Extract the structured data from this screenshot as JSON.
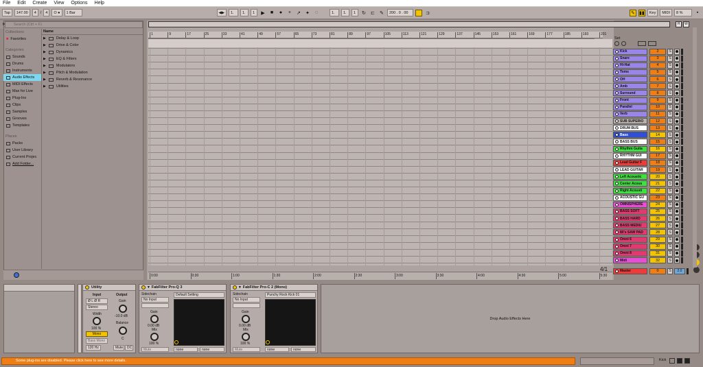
{
  "menu": [
    "File",
    "Edit",
    "Create",
    "View",
    "Options",
    "Help"
  ],
  "control": {
    "tap": "Tap",
    "tempo": "147.00",
    "sig_num": "4",
    "sig_den": "4",
    "quant": "1 Bar",
    "pos1": "1.",
    "pos2": "1.",
    "pos3": "1",
    "loop1": "1.",
    "loop2": "1.",
    "loop3": "1",
    "zoom": "200 . 0 . 00",
    "key": "Key",
    "midi": "MIDI",
    "cpu": "8 %",
    "o": "O ●"
  },
  "browser": {
    "search_placeholder": "Search (Ctrl + F)",
    "collections_header": "Collections",
    "favorites": "Favorites",
    "categories_header": "Categories",
    "categories": [
      "Sounds",
      "Drums",
      "Instruments",
      "Audio Effects",
      "MIDI Effects",
      "Max for Live",
      "Plug-Ins",
      "Clips",
      "Samples",
      "Grooves",
      "Templates"
    ],
    "places_header": "Places",
    "places": [
      "Packs",
      "User Library",
      "Current Projec",
      "Add Folder..."
    ],
    "name_header": "Name",
    "folders": [
      "Delay & Loop",
      "Drive & Color",
      "Dynamics",
      "EQ & Filters",
      "Modulators",
      "Pitch & Modulation",
      "Reverb & Resonance",
      "Utilities"
    ]
  },
  "ruler": {
    "bars": [
      "1",
      "9",
      "17",
      "25",
      "33",
      "41",
      "49",
      "57",
      "65",
      "73",
      "81",
      "89",
      "97",
      "105",
      "113",
      "121",
      "129",
      "137",
      "145",
      "153",
      "161",
      "169",
      "177",
      "185",
      "193",
      "201"
    ],
    "times": [
      "0:00",
      "0:30",
      "1:00",
      "1:30",
      "2:00",
      "2:30",
      "3:00",
      "3:30",
      "4:00",
      "4:30",
      "5:00",
      "5:30"
    ],
    "signature": "4/1",
    "set_label": "Set"
  },
  "tracks": [
    {
      "name": "Kick",
      "num": "2",
      "color": "#9a86e8",
      "numcolor": "#ef7f14"
    },
    {
      "name": "Snare",
      "num": "3",
      "color": "#9a86e8",
      "numcolor": "#ef7f14"
    },
    {
      "name": "Hi-Hat",
      "num": "4",
      "color": "#9a86e8",
      "numcolor": "#ef7f14"
    },
    {
      "name": "Toms",
      "num": "5",
      "color": "#9a86e8",
      "numcolor": "#ef7f14"
    },
    {
      "name": "OH",
      "num": "6",
      "color": "#9a86e8",
      "numcolor": "#ef7f14"
    },
    {
      "name": "Amb",
      "num": "7",
      "color": "#9a86e8",
      "numcolor": "#ef7f14"
    },
    {
      "name": "Surround",
      "num": "8",
      "color": "#9a86e8",
      "numcolor": "#ef7f14"
    },
    {
      "name": "Front",
      "num": "9",
      "color": "#9a86e8",
      "numcolor": "#ef7f14"
    },
    {
      "name": "Parallel",
      "num": "10",
      "color": "#9a86e8",
      "numcolor": "#ef7f14"
    },
    {
      "name": "Verb",
      "num": "11",
      "color": "#9a86e8",
      "numcolor": "#ef7f14"
    },
    {
      "name": "SUB SUPERIO",
      "num": "12",
      "color": "#b9b0ad",
      "numcolor": "#ef7f14"
    },
    {
      "name": "DRUM BUS",
      "num": "13",
      "color": "#ffffff",
      "numcolor": "#ef7f14"
    },
    {
      "name": "Bass",
      "num": "14",
      "color": "#2e4fd6",
      "numcolor": "#f5c400"
    },
    {
      "name": "BASS BUS",
      "num": "15",
      "color": "#ffffff",
      "numcolor": "#ef7f14"
    },
    {
      "name": "Rhythm Guita",
      "num": "16",
      "color": "#3fe03f",
      "numcolor": "#f5c400"
    },
    {
      "name": "RHYTHM GUI",
      "num": "17",
      "color": "#ffffff",
      "numcolor": "#ef7f14"
    },
    {
      "name": "Lead Guitar F",
      "num": "18",
      "color": "#ef3a3a",
      "numcolor": "#ef7f14"
    },
    {
      "name": "LEAD GUITAR",
      "num": "19",
      "color": "#ffffff",
      "numcolor": "#ef7f14"
    },
    {
      "name": "Left Acoustic",
      "num": "20",
      "color": "#3fe03f",
      "numcolor": "#f5c400"
    },
    {
      "name": "Center Acous",
      "num": "21",
      "color": "#3fe03f",
      "numcolor": "#f5c400"
    },
    {
      "name": "Right Acousti",
      "num": "22",
      "color": "#3fe03f",
      "numcolor": "#f5c400"
    },
    {
      "name": "ACOUSTIC GU",
      "num": "23",
      "color": "#ffffff",
      "numcolor": "#ef7f14"
    },
    {
      "name": "OMNISPHERE",
      "num": "24",
      "color": "#e64fd3",
      "numcolor": "#f5c400"
    },
    {
      "name": "BASS SOFT",
      "num": "25",
      "color": "#e03a70",
      "numcolor": "#f5c400"
    },
    {
      "name": "BASS HARD",
      "num": "26",
      "color": "#e03a70",
      "numcolor": "#f5c400"
    },
    {
      "name": "BASS MEDIU",
      "num": "27",
      "color": "#e03a70",
      "numcolor": "#f5c400"
    },
    {
      "name": "80's SAW PAD",
      "num": "28",
      "color": "#e03a70",
      "numcolor": "#f5c400"
    },
    {
      "name": "Omni 6",
      "num": "29",
      "color": "#e03a70",
      "numcolor": "#f5c400"
    },
    {
      "name": "Omni 7",
      "num": "30",
      "color": "#e03a70",
      "numcolor": "#f5c400"
    },
    {
      "name": "Omni 8",
      "num": "31",
      "color": "#e03a70",
      "numcolor": "#f5c400"
    },
    {
      "name": "Midi",
      "num": "32",
      "color": "#e64fd3",
      "numcolor": "#f5c400"
    }
  ],
  "master": {
    "name": "Master",
    "num": "0",
    "extra": "2.0"
  },
  "devices": {
    "utility": {
      "title": "Utility",
      "input": "Input",
      "output": "Output",
      "phase": "Ø L  Ø R",
      "channel": "Stereo",
      "width": "Width",
      "width_val": "100 %",
      "mono": "Mono",
      "bass_mono": "Bass Mono",
      "hz": "120 Hz",
      "gain": "Gain",
      "gain_val": "-10.0 dB",
      "balance": "Balance",
      "balance_val": "C",
      "mute": "Mute",
      "dc": "DC"
    },
    "proq": {
      "title": "FabFilter Pro-Q 3",
      "sidechain": "Sidechain",
      "no_input": "No Input",
      "preset": "Default Setting",
      "gain": "Gain",
      "gain_val": "0.00 dB",
      "mix": "Mix",
      "mix_val": "100 %",
      "mute": "Mute",
      "none1": "none",
      "none2": "none"
    },
    "proc": {
      "title": "FabFilter Pro-C 2 (Mono)",
      "sidechain": "Sidechain",
      "no_input": "No Input",
      "preset": "Punchy Rock Kick 01",
      "gain": "Gain",
      "gain_val": "0.00 dB",
      "mix": "Mix",
      "mix_val": "100 %",
      "mute": "Mute",
      "none1": "none",
      "none2": "none"
    },
    "drop": "Drop Audio Effects Here"
  },
  "status": {
    "message": "Some plug-ins are disabled. Please click here to see more details.",
    "kick": "Kick"
  }
}
